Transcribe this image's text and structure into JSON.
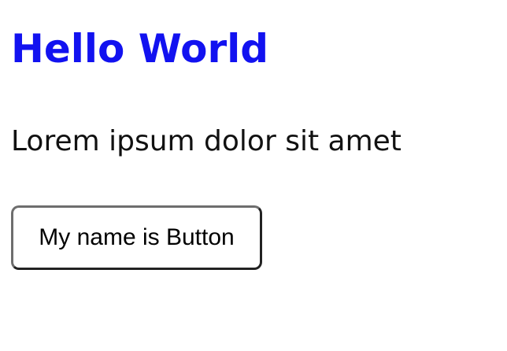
{
  "heading": {
    "text": "Hello World",
    "color": "#1212f0"
  },
  "paragraph": {
    "text": "Lorem ipsum dolor sit amet"
  },
  "button": {
    "label": "My name is Button"
  }
}
